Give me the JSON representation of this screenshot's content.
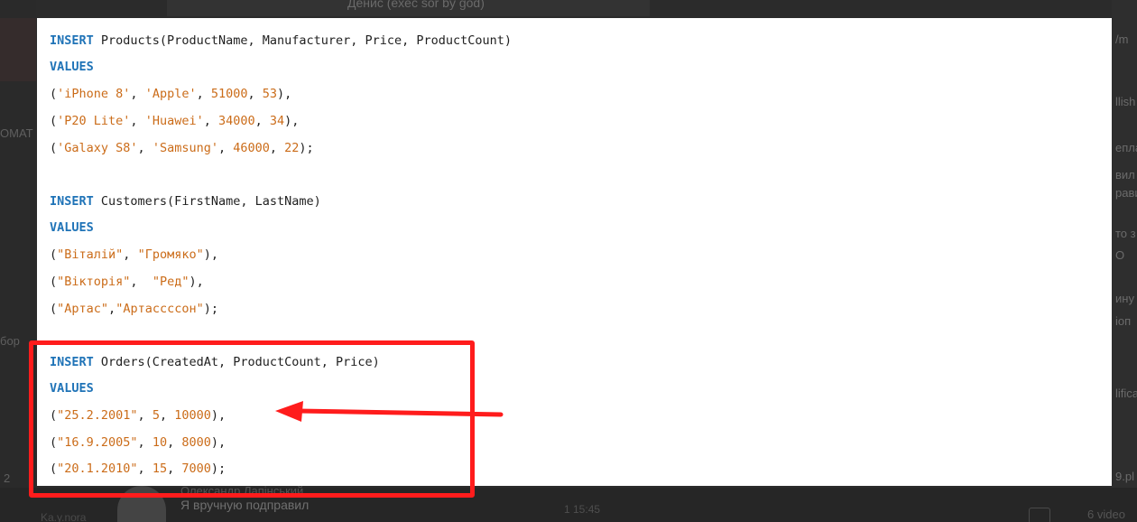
{
  "background": {
    "top_text": "Денис (exec sor by god)",
    "right_snippets": [
      "/m",
      "llish",
      "епла",
      "вил",
      "равил",
      "то з",
      "О",
      "ину",
      "іоп",
      "lifica",
      "9.pl"
    ],
    "left_snippets": [
      "ОМАТ",
      "бор",
      "2"
    ],
    "message_name": "Олександр Лапінський",
    "message_text": "Я вручную подправил",
    "message_time": "1 15:45",
    "bottom_right_text": "6 video",
    "bottom_left_text": "Ka.y.nora"
  },
  "code": {
    "products": {
      "insert_kw": "INSERT",
      "insert_rest": " Products(ProductName, Manufacturer, Price, ProductCount)",
      "values_kw": "VALUES",
      "rows": [
        [
          "'iPhone 8'",
          "'Apple'",
          "51000",
          "53",
          "),"
        ],
        [
          "'P20 Lite'",
          "'Huawei'",
          "34000",
          "34",
          "),"
        ],
        [
          "'Galaxy S8'",
          "'Samsung'",
          "46000",
          "22",
          ");"
        ]
      ]
    },
    "customers": {
      "insert_kw": "INSERT",
      "insert_rest": " Customers(FirstName, LastName)",
      "values_kw": "VALUES",
      "rows": [
        {
          "a": "\"Віталій\"",
          "sep": ", ",
          "b": "\"Громяко\"",
          "end": "),"
        },
        {
          "a": "\"Вікторія\"",
          "sep": ",  ",
          "b": "\"Ред\"",
          "end": "),"
        },
        {
          "a": "\"Артас\"",
          "sep": ",",
          "b": "\"Артассссон\"",
          "end": ");"
        }
      ]
    },
    "orders": {
      "insert_kw": "INSERT",
      "insert_rest": " Orders(CreatedAt, ProductCount, Price)",
      "values_kw": "VALUES",
      "rows": [
        [
          "\"25.2.2001\"",
          "5",
          "10000",
          "),"
        ],
        [
          "\"16.9.2005\"",
          "10",
          "8000",
          "),"
        ],
        [
          "\"20.1.2010\"",
          "15",
          "7000",
          ");"
        ]
      ]
    }
  },
  "annotation": {
    "box_color": "#ff1c1c",
    "arrow_color": "#ff1c1c"
  }
}
